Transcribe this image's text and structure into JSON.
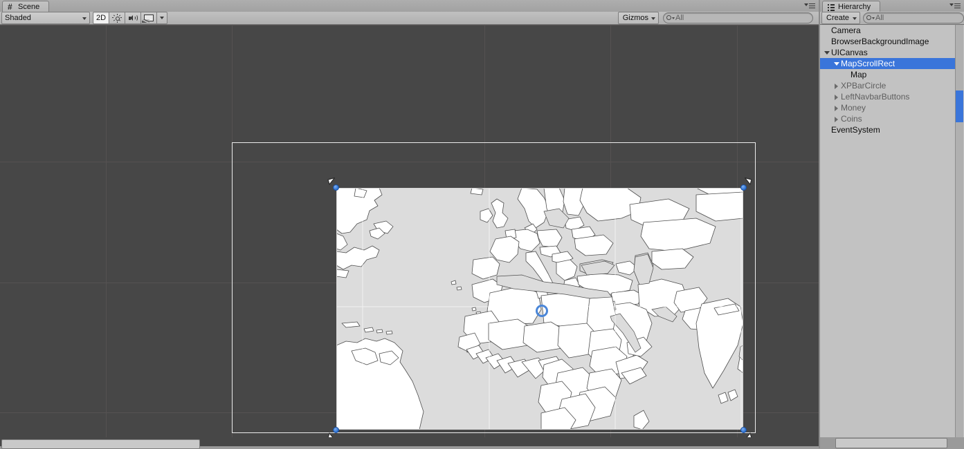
{
  "window": {
    "editor": "Unity Editor"
  },
  "scene_panel": {
    "tab": {
      "label": "Scene",
      "icon": "grid-hash-icon"
    },
    "menu_icon": "panel-context-menu-icon",
    "toolbar": {
      "draw_mode": {
        "value": "Shaded",
        "icon": "chevron-down-icon"
      },
      "two_d_toggle": {
        "label": "2D",
        "active": true
      },
      "lighting_toggle": {
        "icon": "sun-icon",
        "active": false
      },
      "audio_toggle": {
        "icon": "speaker-icon",
        "active": false
      },
      "effects_toggle": {
        "icon": "image-icon",
        "active": false
      },
      "effects_dropdown": {
        "icon": "chevron-down-icon"
      },
      "gizmos": {
        "label": "Gizmos",
        "icon": "chevron-down-icon"
      },
      "search": {
        "value": "All",
        "placeholder": "Search",
        "icon": "search-icon"
      }
    },
    "viewport": {
      "background_color": "#474747",
      "grid_color": "#555252",
      "canvas_rect_color": "#ededed",
      "selection": {
        "object": "MapScrollRect",
        "rect_outline_color": "#d8d8d8",
        "handle_color": "#2a6fd0",
        "pivot_color": "#4a86d8",
        "handles": [
          "top-left",
          "top-right",
          "bottom-left",
          "bottom-right"
        ],
        "anchors": [
          "top-left",
          "top-right",
          "bottom-left",
          "bottom-right"
        ]
      },
      "map": {
        "name": "world-political-map",
        "ocean_color": "#dcdcdc",
        "land_color": "#ffffff",
        "border_color": "#4d4d4d",
        "graticule_color": "#ffffff"
      }
    },
    "scrollbar": {
      "orientation": "horizontal"
    }
  },
  "hierarchy_panel": {
    "tab": {
      "label": "Hierarchy",
      "icon": "list-icon"
    },
    "menu_icon": "panel-context-menu-icon",
    "toolbar": {
      "create": {
        "label": "Create",
        "icon": "chevron-down-icon"
      },
      "search": {
        "value": "All",
        "placeholder": "Search",
        "icon": "search-icon"
      }
    },
    "tree": [
      {
        "label": "Camera",
        "depth": 0,
        "twisty": "none",
        "selected": false,
        "dim": false
      },
      {
        "label": "BrowserBackgroundImage",
        "depth": 0,
        "twisty": "none",
        "selected": false,
        "dim": false
      },
      {
        "label": "UICanvas",
        "depth": 0,
        "twisty": "open",
        "selected": false,
        "dim": false
      },
      {
        "label": "MapScrollRect",
        "depth": 1,
        "twisty": "open",
        "selected": true,
        "dim": false
      },
      {
        "label": "Map",
        "depth": 2,
        "twisty": "none",
        "selected": false,
        "dim": false
      },
      {
        "label": "XPBarCircle",
        "depth": 1,
        "twisty": "closed",
        "selected": false,
        "dim": true
      },
      {
        "label": "LeftNavbarButtons",
        "depth": 1,
        "twisty": "closed",
        "selected": false,
        "dim": true
      },
      {
        "label": "Money",
        "depth": 1,
        "twisty": "closed",
        "selected": false,
        "dim": true
      },
      {
        "label": "Coins",
        "depth": 1,
        "twisty": "closed",
        "selected": false,
        "dim": true
      },
      {
        "label": "EventSystem",
        "depth": 0,
        "twisty": "none",
        "selected": false,
        "dim": false
      }
    ],
    "selection_color": "#3a75da"
  }
}
